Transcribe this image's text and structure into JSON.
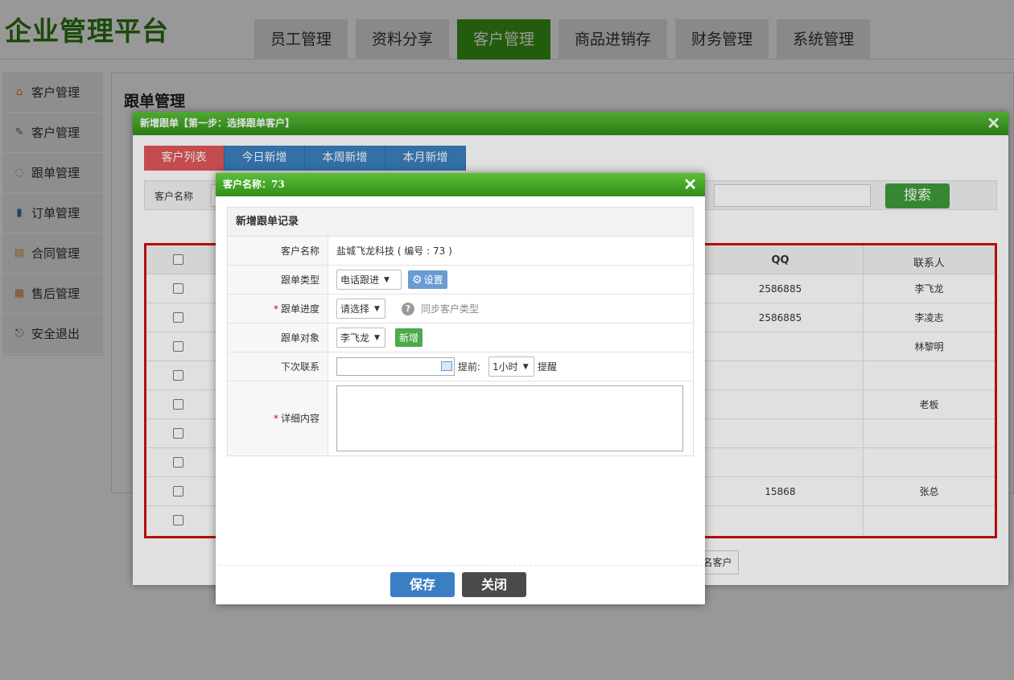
{
  "header": {
    "logo": "企业管理平台",
    "nav": [
      "员工管理",
      "资料分享",
      "客户管理",
      "商品进销存",
      "财务管理",
      "系统管理"
    ],
    "active_nav_index": 2
  },
  "sidebar": {
    "items": [
      {
        "label": "客户管理",
        "icon": "home-icon"
      },
      {
        "label": "客户管理",
        "icon": "edit-icon"
      },
      {
        "label": "跟单管理",
        "icon": "chat-icon"
      },
      {
        "label": "订单管理",
        "icon": "order-icon"
      },
      {
        "label": "合同管理",
        "icon": "contract-icon"
      },
      {
        "label": "售后管理",
        "icon": "service-icon"
      },
      {
        "label": "安全退出",
        "icon": "exit-icon"
      }
    ]
  },
  "main": {
    "title": "跟单管理"
  },
  "dialog_main": {
    "title": "新增跟单【第一步：选择跟单客户】",
    "close": "✕",
    "tabs": [
      "客户列表",
      "今日新增",
      "本周新增",
      "本月新增"
    ],
    "search": {
      "label": "客户名称",
      "button": "搜索"
    },
    "table": {
      "headers": {
        "qq": "QQ",
        "contact": "联系人"
      },
      "rows": [
        {
          "qq": "2586885",
          "contact": "李飞龙"
        },
        {
          "qq": "2586885",
          "contact": "李凌志"
        },
        {
          "qq": "",
          "contact": "林黎明"
        },
        {
          "qq": "",
          "contact": ""
        },
        {
          "qq": "",
          "contact": "老板"
        },
        {
          "qq": "",
          "contact": ""
        },
        {
          "qq": "",
          "contact": ""
        },
        {
          "qq": "15868",
          "contact": "张总"
        },
        {
          "qq": "",
          "contact": ""
        }
      ]
    },
    "footer_button": "名客户"
  },
  "dialog_sub": {
    "title": "客户名称：73",
    "close": "✕",
    "form_title": "新增跟单记录",
    "fields": {
      "customer_name": {
        "label": "客户名称",
        "value": "盐城飞龙科技 ( 编号 : 73 )"
      },
      "type": {
        "label": "跟单类型",
        "value": "电话跟进",
        "settings": "设置"
      },
      "progress": {
        "label": "跟单进度",
        "value": "请选择",
        "hint": "同步客户类型"
      },
      "target": {
        "label": "跟单对象",
        "value": "李飞龙",
        "add": "新增"
      },
      "next_contact": {
        "label": "下次联系",
        "advance_label": "提前:",
        "advance_value": "1小时",
        "remind": "提醒"
      },
      "detail": {
        "label": "详细内容"
      }
    },
    "buttons": {
      "save": "保存",
      "close": "关闭"
    }
  },
  "colors": {
    "brand_green": "#3d9b17",
    "tab_active": "#e0565b",
    "tab_default": "#3a80bf",
    "table_border": "#cc1111"
  }
}
